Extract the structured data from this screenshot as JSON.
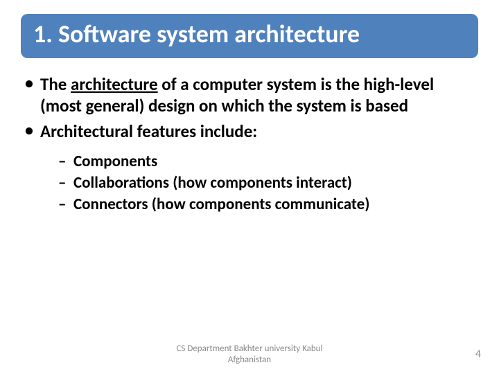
{
  "title": "1. Software system architecture",
  "bullets": {
    "b1_pre": "The ",
    "b1_underlined": "architecture",
    "b1_post": " of a computer system is the high-level (most general) design on which the system is based",
    "b2": "Architectural features include:",
    "sub1": "Components",
    "sub2": "Collaborations (how components interact)",
    "sub3": "Connectors (how components communicate)"
  },
  "footer": {
    "line1": "CS Department Bakhter university Kabul",
    "line2": "Afghanistan",
    "page": "4"
  }
}
